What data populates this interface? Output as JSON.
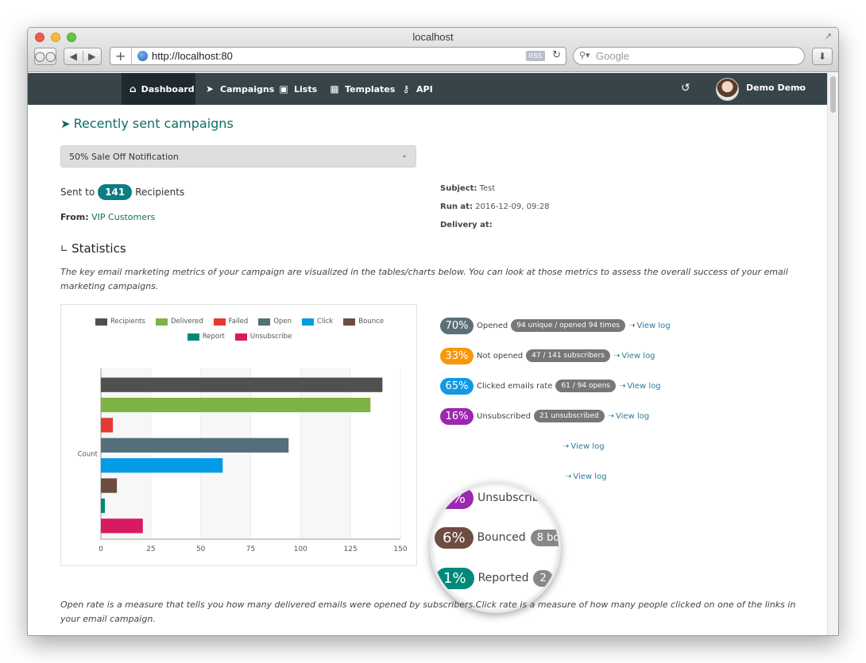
{
  "window": {
    "title": "localhost"
  },
  "browser": {
    "url": "http://localhost:80",
    "rss_label": "RSS",
    "search_placeholder": "Google"
  },
  "nav": {
    "items": [
      {
        "label": "Dashboard",
        "icon": "home-icon",
        "active": true
      },
      {
        "label": "Campaigns",
        "icon": "paper-plane-icon"
      },
      {
        "label": "Lists",
        "icon": "address-book-icon"
      },
      {
        "label": "Templates",
        "icon": "template-icon"
      },
      {
        "label": "API",
        "icon": "key-icon"
      }
    ],
    "user_name": "Demo Demo",
    "colors": {
      "background": "#374449",
      "active": "#1f2a2e"
    }
  },
  "page": {
    "title": "Recently sent campaigns",
    "campaign_selected": "50% Sale Off Notification",
    "sent_to_prefix": "Sent to",
    "recipients_count": "141",
    "sent_to_suffix": "Recipients",
    "from_label": "From:",
    "from_value": "VIP Customers",
    "subject_label": "Subject:",
    "subject_value": "Test",
    "run_at_label": "Run at:",
    "run_at_value": "2016-12-09, 09:28",
    "delivery_at_label": "Delivery at:",
    "delivery_at_value": ""
  },
  "statistics": {
    "title": "Statistics",
    "description": "The key email marketing metrics of your campaign are visualized in the tables/charts below. You can look at those metrics to assess the overall success of your email marketing campaigns.",
    "footnote": "Open rate is a measure that tells you how many delivered emails were opened by subscribers.Click rate is a measure of how many people clicked on one of the links in your email campaign.",
    "rows": [
      {
        "pct": "70%",
        "label": "Opened",
        "detail": "94 unique / opened 94 times",
        "link": "View log",
        "color": "#5b6e7a"
      },
      {
        "pct": "33%",
        "label": "Not opened",
        "detail": "47 / 141 subscribers",
        "link": "View log",
        "color": "#f7970c"
      },
      {
        "pct": "65%",
        "label": "Clicked emails rate",
        "detail": "61 / 94 opens",
        "link": "View log",
        "color": "#1199e3"
      },
      {
        "pct": "16%",
        "label": "Unsubscribed",
        "detail": "21 unsubscribed",
        "link": "View log",
        "color": "#9c27b0"
      },
      {
        "pct": "",
        "label": "",
        "detail": "",
        "link": "View log",
        "color": ""
      },
      {
        "pct": "",
        "label": "",
        "detail": "",
        "link": "View log",
        "color": ""
      }
    ],
    "magnifier": [
      {
        "pct": "16%",
        "label": "Unsubscrib",
        "detail": "",
        "color": "#9c27b0"
      },
      {
        "pct": "6%",
        "label": "Bounced",
        "detail": "8 bou",
        "color": "#6d4c41"
      },
      {
        "pct": "1%",
        "label": "Reported",
        "detail": "2",
        "color": "#00897b"
      }
    ]
  },
  "chart_data": {
    "type": "bar",
    "orientation": "horizontal",
    "categories": [
      "Recipients",
      "Delivered",
      "Failed",
      "Open",
      "Click",
      "Bounce",
      "Report",
      "Unsubscribe"
    ],
    "values": [
      141,
      135,
      6,
      94,
      61,
      8,
      2,
      21
    ],
    "colors": [
      "#505050",
      "#7cb342",
      "#e53935",
      "#546e7a",
      "#039be5",
      "#6d4c41",
      "#00897b",
      "#d81b60"
    ],
    "legend": [
      "Recipients",
      "Delivered",
      "Failed",
      "Open",
      "Click",
      "Bounce",
      "Report",
      "Unsubscribe"
    ],
    "legend_position": "top",
    "ylabel": "Count",
    "xlabel": "",
    "xticks": [
      "0",
      "25",
      "50",
      "75",
      "100",
      "125",
      "150"
    ],
    "xlim": [
      0,
      150
    ],
    "grid": true
  }
}
